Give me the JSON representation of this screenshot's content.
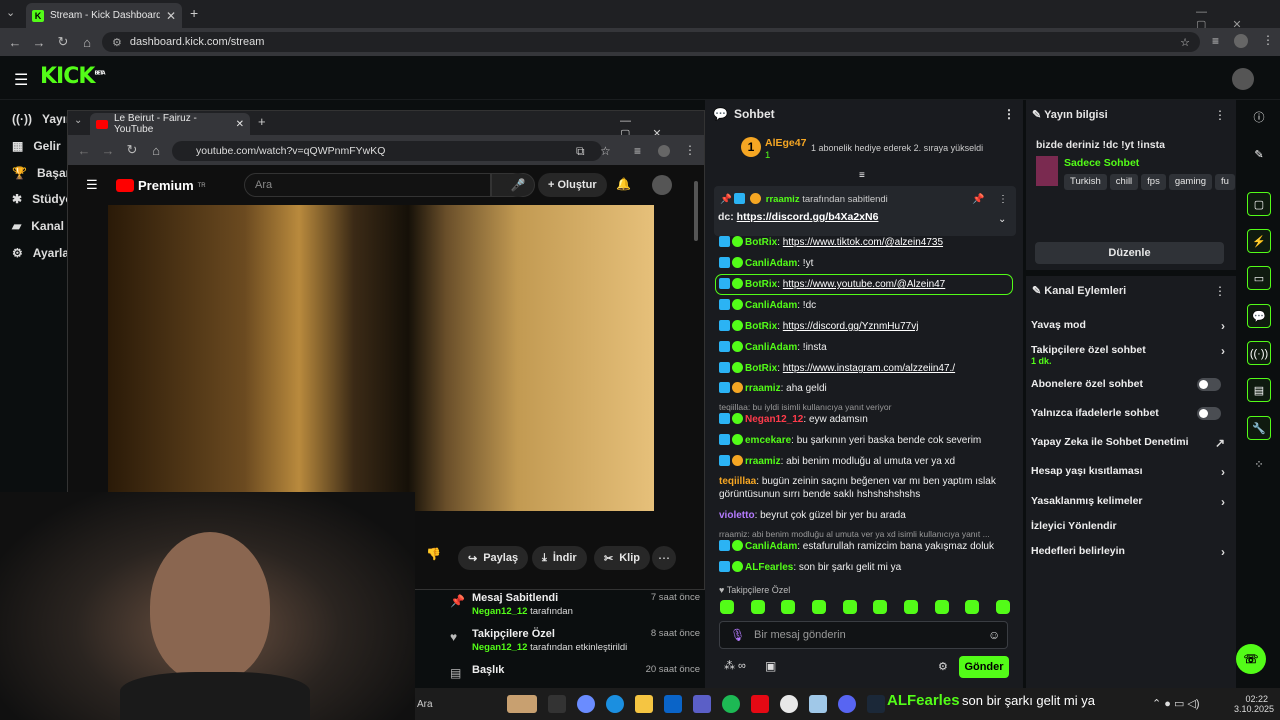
{
  "browser": {
    "tab_title": "Stream - Kick Dashboard",
    "url": "dashboard.kick.com/stream"
  },
  "kick": {
    "logo": "KICK",
    "beta": "BETA",
    "nav": [
      "Yayın",
      "Gelir",
      "Başarı",
      "Stüdyo",
      "Kanal",
      "Ayarla"
    ]
  },
  "youtube": {
    "tab_title": "Le Beirut - Fairuz - YouTube",
    "url": "youtube.com/watch?v=qQWPnmFYwKQ",
    "brand": "Premium",
    "brand_sup": "TR",
    "search_placeholder": "Ara",
    "create_label": "Oluştur",
    "buttons": {
      "share": "Paylaş",
      "download": "İndir",
      "clip": "Klip"
    }
  },
  "events": [
    {
      "title": "Mesaj Sabitlendi",
      "user": "Negan12_12",
      "suffix": "tarafından",
      "time": "7 saat önce"
    },
    {
      "title": "Takipçilere Özel",
      "user": "Negan12_12",
      "suffix": "tarafından etkinleştirildi",
      "time": "8 saat önce"
    },
    {
      "title": "Başlık",
      "user": "",
      "suffix": "",
      "time": "20 saat önce"
    }
  ],
  "chat": {
    "title": "Sohbet",
    "top_user": "AlEge47",
    "top_count": "1",
    "gift_text": "1 abonelik hediye ederek 2. sıraya yükseldi",
    "pinned": {
      "by_user": "rraamiz",
      "by_suffix": "tarafından sabitlendi",
      "text_prefix": "dc:",
      "link": "https://discord.gg/b4Xa2xN6"
    },
    "messages": [
      {
        "user": "BotRix",
        "text": "https://www.tiktok.com/@alzein4735",
        "color": "#53fc18",
        "link": true
      },
      {
        "user": "CanliAdam",
        "text": "!yt",
        "color": "#53fc18",
        "link": false
      },
      {
        "user": "BotRix",
        "text": "https://www.youtube.com/@Alzein47",
        "color": "#53fc18",
        "link": true
      },
      {
        "user": "CanliAdam",
        "text": "!dc",
        "color": "#53fc18",
        "link": false
      },
      {
        "user": "BotRix",
        "text": "https://discord.gg/YznmHu77vj",
        "color": "#53fc18",
        "link": true
      },
      {
        "user": "CanliAdam",
        "text": "!insta",
        "color": "#53fc18",
        "link": false
      },
      {
        "user": "BotRix",
        "text": "https://www.instagram.com/alzzeiin47./",
        "color": "#53fc18",
        "link": true
      },
      {
        "user": "rraamiz",
        "text": "aha geldi",
        "color": "#53fc18",
        "link": false
      },
      {
        "user": "Negan12_12",
        "text": "eyw adamsın",
        "color": "#ff3b4b",
        "link": false,
        "reply": "teqiillaa: bu iyldi isimli kullanıcıya yanıt veriyor"
      },
      {
        "user": "emcekare",
        "text": "bu şarkının yeri baska bende cok severim",
        "color": "#53fc18",
        "link": false
      },
      {
        "user": "rraamiz",
        "text": "abi benim modluğu al umuta ver ya xd",
        "color": "#53fc18",
        "link": false
      },
      {
        "user": "teqiillaa",
        "text": "bugün zeinin saçını beğenen var mı ben yaptım ıslak görüntüsunun sırrı bende saklı hshshshshshs",
        "color": "#f5a623",
        "link": false
      },
      {
        "user": "violetto",
        "text": "beyrut çok güzel bir yer bu arada",
        "color": "#b57bff",
        "link": false
      },
      {
        "user": "CanliAdam",
        "text": "estafurullah ramizcim bana yakışmaz doluk",
        "color": "#53fc18",
        "link": false,
        "reply": "rraamiz: abi benim modluğu al umuta ver ya xd isimli kullanıcıya yanıt ..."
      },
      {
        "user": "ALFearles",
        "text": "son bir şarkı gelit mi ya",
        "color": "#53fc18",
        "link": false
      }
    ],
    "followers_only": "Takipçilere Özel",
    "input_placeholder": "Bir mesaj gönderin",
    "send_label": "Gönder"
  },
  "stream_info": {
    "panel_title": "Yayın bilgisi",
    "stream_title": "bizde deriniz !dc !yt !insta",
    "category": "Sadece Sohbet",
    "tags": [
      "Turkish",
      "chill",
      "fps",
      "gaming",
      "fu"
    ],
    "edit_label": "Düzenle"
  },
  "channel_actions": {
    "panel_title": "Kanal Eylemleri",
    "items": [
      {
        "label": "Yavaş mod",
        "type": "chevron"
      },
      {
        "label": "Takipçilere özel sohbet",
        "sub": "1 dk.",
        "type": "chevron"
      },
      {
        "label": "Abonelere özel sohbet",
        "type": "toggle"
      },
      {
        "label": "Yalnızca ifadelerle sohbet",
        "type": "toggle"
      },
      {
        "label": "Yapay Zeka ile Sohbet Denetimi",
        "type": "external"
      },
      {
        "label": "Hesap yaşı kısıtlaması",
        "type": "chevron"
      },
      {
        "label": "Yasaklanmış kelimeler",
        "type": "chevron"
      },
      {
        "label": "İzleyici Yönlendir",
        "type": "none"
      },
      {
        "label": "Hedefleri belirleyin",
        "type": "chevron"
      }
    ]
  },
  "taskbar": {
    "search": "Ara",
    "now_playing_user": "ALFearles",
    "now_playing_text": "son bir şarkı gelit mi ya",
    "time": "02:22",
    "date": "3.10.2025"
  },
  "colors": {
    "kick_green": "#53fc18",
    "panel": "#191b1f",
    "bg": "#0b0e0f"
  }
}
